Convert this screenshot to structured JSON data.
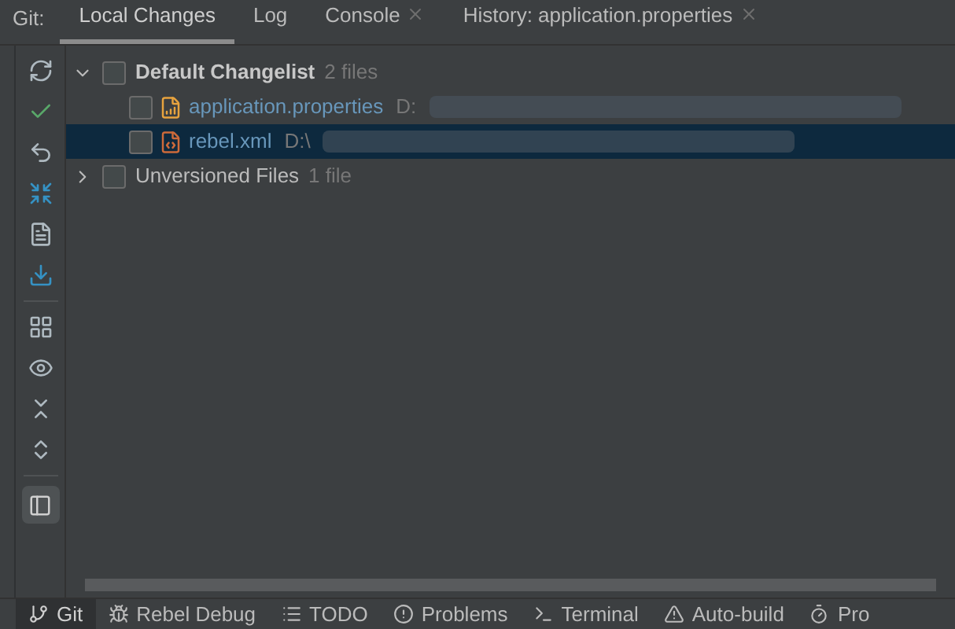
{
  "tool_window": {
    "title": "Git:"
  },
  "tabs": [
    {
      "label": "Local Changes",
      "selected": true,
      "closable": false
    },
    {
      "label": "Log",
      "selected": false,
      "closable": false
    },
    {
      "label": "Console",
      "selected": false,
      "closable": true
    },
    {
      "label": "History: application.properties",
      "selected": false,
      "closable": true
    }
  ],
  "tree": [
    {
      "label": "Default Changelist",
      "count": "2 files",
      "expanded": true,
      "checked": false,
      "selected": false,
      "children": [
        {
          "kind": "properties",
          "name": "application.properties",
          "path": "D:",
          "checked": false,
          "selected": false
        },
        {
          "kind": "xml",
          "name": "rebel.xml",
          "path": "D:\\",
          "checked": false,
          "selected": true
        }
      ]
    },
    {
      "label": "Unversioned Files",
      "count": "1 file",
      "expanded": false,
      "checked": false,
      "selected": false
    }
  ],
  "status_bar": [
    {
      "kind": "git",
      "label": "Git",
      "selected": true
    },
    {
      "kind": "rebel",
      "label": "Rebel Debug",
      "selected": false
    },
    {
      "kind": "todo",
      "label": "TODO",
      "selected": false
    },
    {
      "kind": "problems",
      "label": "Problems",
      "selected": false
    },
    {
      "kind": "terminal",
      "label": "Terminal",
      "selected": false
    },
    {
      "kind": "build",
      "label": "Auto-build",
      "selected": false
    },
    {
      "kind": "profiler",
      "label": "Pro",
      "selected": false
    }
  ]
}
